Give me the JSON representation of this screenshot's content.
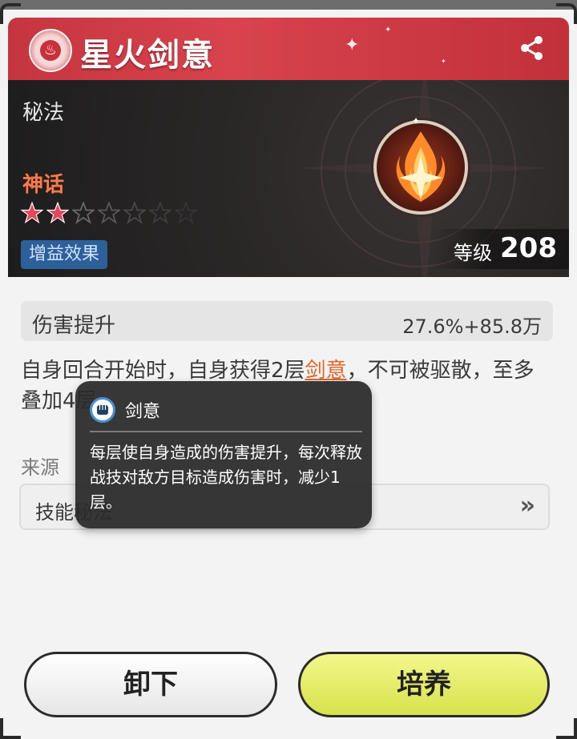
{
  "header": {
    "title": "星火剑意",
    "emblem_icon": "flame-crest-icon",
    "share_icon": "share-icon",
    "accent_color": "#c53540"
  },
  "info": {
    "category": "秘法",
    "rarity": "神话",
    "rarity_color": "#ff7a4a",
    "stars_filled": 2,
    "stars_total": 7,
    "badge": "增益效果",
    "level_label": "等级",
    "level_value": "208",
    "skill_icon": "flaming-sword-icon"
  },
  "stat": {
    "label": "伤害提升",
    "value": "27.6%+85.8万"
  },
  "description": {
    "part1": "自身回合开始时，自身获得2层",
    "keyword": "剑意",
    "part2": "，不可被驱散，至多叠加4层"
  },
  "source": {
    "label": "来源",
    "value": "技能秘法",
    "arrow": "»"
  },
  "tooltip": {
    "title": "剑意",
    "icon": "fist-icon",
    "body": "每层使自身造成的伤害提升，每次释放战技对敌方目标造成伤害时，减少1层。"
  },
  "buttons": {
    "unequip": "卸下",
    "upgrade": "培养"
  }
}
